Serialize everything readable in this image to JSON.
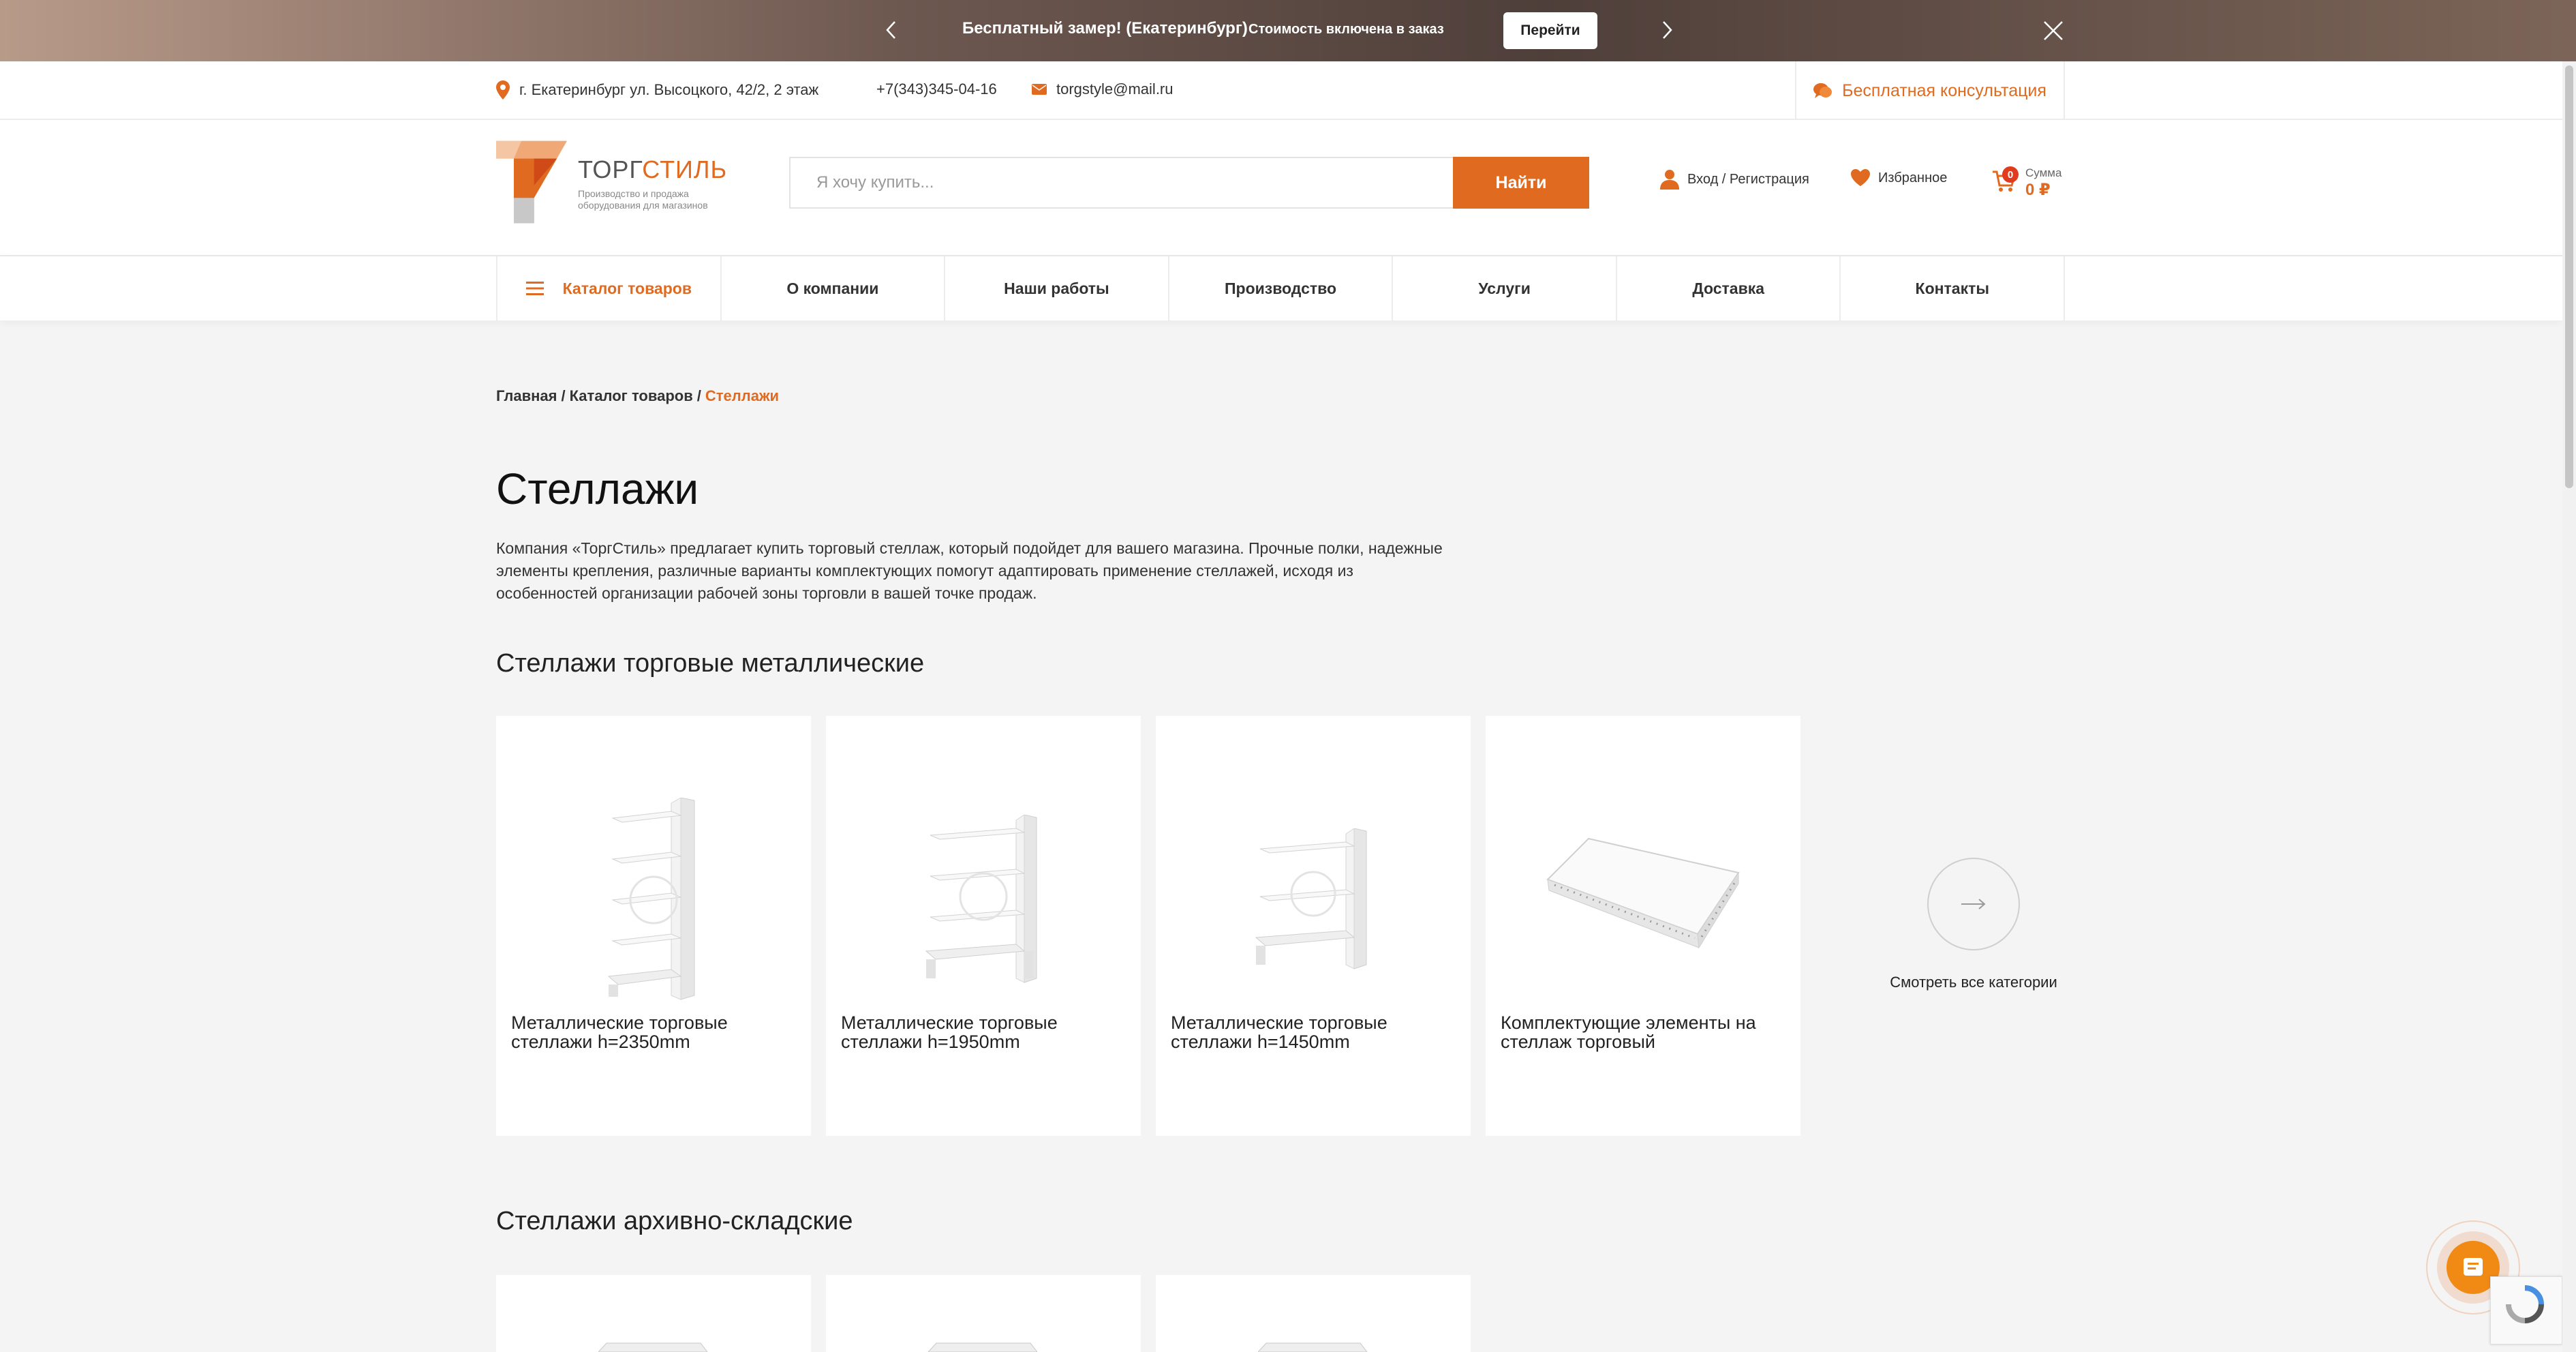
{
  "promo": {
    "title": "Бесплатный замер! (Екатеринбург)",
    "subtitle": "Стоимость включена в заказ",
    "button": "Перейти"
  },
  "contacts": {
    "address": "г. Екатеринбург ул. Высоцкого, 42/2, 2 этаж",
    "phone": "+7(343)345-04-16",
    "email": "torgstyle@mail.ru",
    "consultation": "Бесплатная консультация"
  },
  "logo": {
    "brand_a": "ТОРГ",
    "brand_b": "СТИЛЬ",
    "tagline": "Производство и продажа оборудования для магазинов"
  },
  "search": {
    "placeholder": "Я хочу купить...",
    "button": "Найти"
  },
  "header": {
    "login": "Вход / Регистрация",
    "favorites": "Избранное",
    "cart_count": "0",
    "cart_sum_label": "Сумма",
    "cart_sum_value": "0 ₽"
  },
  "nav": {
    "items": [
      "Каталог товаров",
      "О компании",
      "Наши работы",
      "Производство",
      "Услуги",
      "Доставка",
      "Контакты"
    ]
  },
  "breadcrumb": {
    "home": "Главная",
    "catalog": "Каталог товаров",
    "current": "Стеллажи"
  },
  "page": {
    "title": "Стеллажи",
    "intro": "Компания «ТоргСтиль» предлагает купить торговый стеллаж, который подойдет для вашего магазина. Прочные полки, надежные элементы крепления, различные варианты комплектующих помогут адаптировать применение стеллажей, исходя из особенностей организации рабочей зоны торговли в вашей точке продаж."
  },
  "sections": [
    {
      "title": "Стеллажи торговые металлические",
      "cards": [
        "Металлические торговые стеллажи h=2350mm",
        "Металлические торговые стеллажи h=1950mm",
        "Металлические торговые стеллажи h=1450mm",
        "Комплектующие элементы на стеллаж торговый"
      ],
      "see_all": "Смотреть все категории"
    },
    {
      "title": "Стеллажи архивно-складские"
    }
  ],
  "colors": {
    "accent": "#e06a1f",
    "background": "#f4f4f4"
  }
}
